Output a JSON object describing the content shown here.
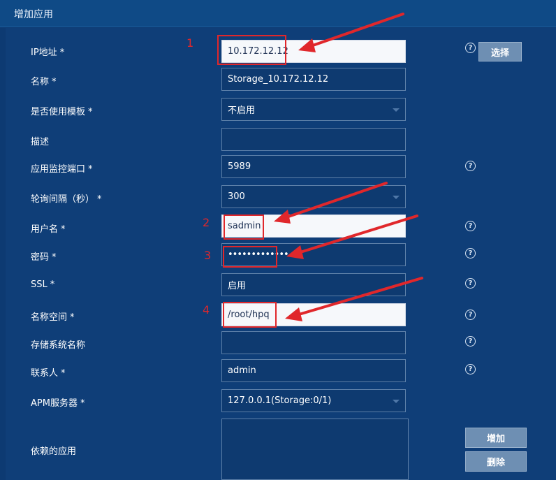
{
  "window": {
    "title": "增加应用"
  },
  "form": {
    "ip": {
      "label": "IP地址",
      "required": "*",
      "value": "10.172.12.12"
    },
    "name": {
      "label": "名称",
      "required": "*",
      "value": "Storage_10.172.12.12"
    },
    "template": {
      "label": "是否使用模板",
      "required": "*",
      "value": "不启用"
    },
    "desc": {
      "label": "描述",
      "value": ""
    },
    "port": {
      "label": "应用监控端口",
      "required": "*",
      "value": "5989"
    },
    "interval": {
      "label": "轮询间隔（秒）",
      "required": "*",
      "value": "300"
    },
    "username": {
      "label": "用户名",
      "required": "*",
      "value": "sadmin"
    },
    "password": {
      "label": "密码",
      "required": "*",
      "value": "•••••••••••••"
    },
    "ssl": {
      "label": "SSL",
      "required": "*",
      "value": "启用"
    },
    "namespace": {
      "label": "名称空间",
      "required": "*",
      "value": "/root/hpq"
    },
    "storage_name": {
      "label": "存储系统名称",
      "value": ""
    },
    "contact": {
      "label": "联系人",
      "required": "*",
      "value": "admin"
    },
    "apm": {
      "label": "APM服务器",
      "required": "*",
      "value": "127.0.0.1(Storage:0/1)"
    },
    "deps": {
      "label": "依赖的应用"
    }
  },
  "buttons": {
    "select": "选择",
    "add": "增加",
    "delete": "删除"
  },
  "help_glyph": "?",
  "annotations": {
    "n1": "1",
    "n2": "2",
    "n3": "3",
    "n4": "4"
  },
  "colors": {
    "background": "#0d3a72",
    "annotation": "#e0272b",
    "button": "#6e8fb3"
  }
}
